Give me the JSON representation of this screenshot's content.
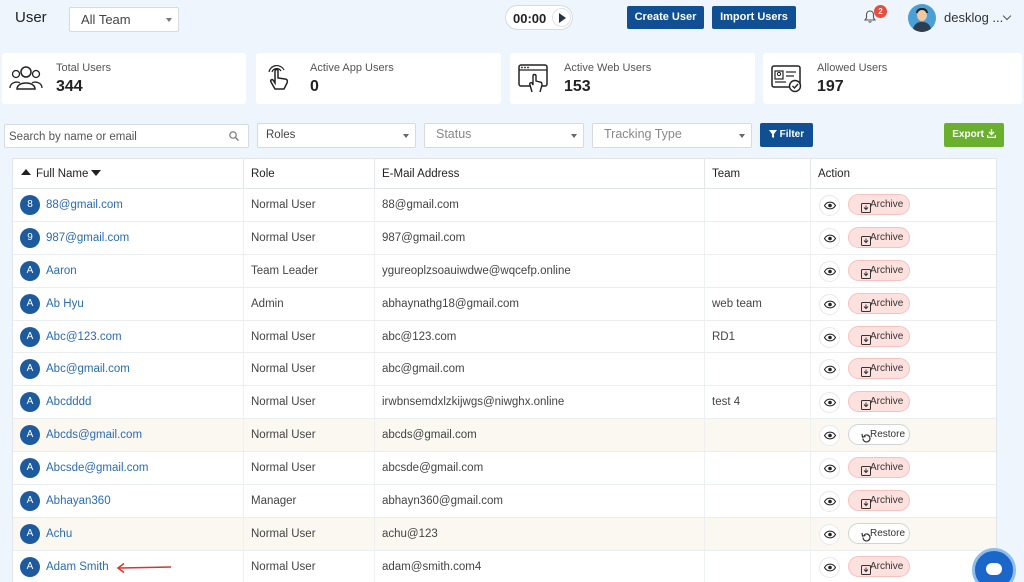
{
  "header": {
    "title": "User",
    "team_select": "All Team",
    "timer": "00:00",
    "create_label": "Create User",
    "import_label": "Import Users",
    "notif_count": "2",
    "username": "desklog ..."
  },
  "stats": [
    {
      "label": "Total Users",
      "value": "344",
      "icon": "users-group-icon"
    },
    {
      "label": "Active App Users",
      "value": "0",
      "icon": "hand-tap-icon"
    },
    {
      "label": "Active Web Users",
      "value": "153",
      "icon": "browser-click-icon"
    },
    {
      "label": "Allowed Users",
      "value": "197",
      "icon": "id-card-check-icon"
    }
  ],
  "filters": {
    "search_placeholder": "Search by name or email",
    "roles": "Roles",
    "status": "Status",
    "tracking": "Tracking Type",
    "filter_label": "Filter",
    "export_label": "Export"
  },
  "table": {
    "headers": [
      "Full Name",
      "Role",
      "E-Mail Address",
      "Team",
      "Action"
    ],
    "rows": [
      {
        "initial": "8",
        "name": "88@gmail.com",
        "role": "Normal User",
        "email": "88@gmail.com",
        "team": "",
        "action": "Archive"
      },
      {
        "initial": "9",
        "name": "987@gmail.com",
        "role": "Normal User",
        "email": "987@gmail.com",
        "team": "",
        "action": "Archive"
      },
      {
        "initial": "A",
        "name": "Aaron",
        "role": "Team Leader",
        "email": "ygureoplzsoauiwdwe@wqcefp.online",
        "team": "",
        "action": "Archive"
      },
      {
        "initial": "A",
        "name": "Ab Hyu",
        "role": "Admin",
        "email": "abhaynathg18@gmail.com",
        "team": "web team",
        "action": "Archive"
      },
      {
        "initial": "A",
        "name": "Abc@123.com",
        "role": "Normal User",
        "email": "abc@123.com",
        "team": "RD1",
        "action": "Archive"
      },
      {
        "initial": "A",
        "name": "Abc@gmail.com",
        "role": "Normal User",
        "email": "abc@gmail.com",
        "team": "",
        "action": "Archive"
      },
      {
        "initial": "A",
        "name": "Abcdddd",
        "role": "Normal User",
        "email": "irwbnsemdxlzkijwgs@niwghx.online",
        "team": "test 4",
        "action": "Archive"
      },
      {
        "initial": "A",
        "name": "Abcds@gmail.com",
        "role": "Normal User",
        "email": "abcds@gmail.com",
        "team": "",
        "action": "Restore"
      },
      {
        "initial": "A",
        "name": "Abcsde@gmail.com",
        "role": "Normal User",
        "email": "abcsde@gmail.com",
        "team": "",
        "action": "Archive"
      },
      {
        "initial": "A",
        "name": "Abhayan360",
        "role": "Manager",
        "email": "abhayn360@gmail.com",
        "team": "",
        "action": "Archive"
      },
      {
        "initial": "A",
        "name": "Achu",
        "role": "Normal User",
        "email": "achu@123",
        "team": "",
        "action": "Restore"
      },
      {
        "initial": "A",
        "name": "Adam Smith",
        "role": "Normal User",
        "email": "adam@smith.com4",
        "team": "",
        "action": "Archive"
      }
    ]
  },
  "colors": {
    "primary": "#0f4f92",
    "export": "#6ab02e",
    "link": "#2b6cb0",
    "archive_bg": "#fde1df",
    "annotation_arrow": "#d9342b"
  }
}
